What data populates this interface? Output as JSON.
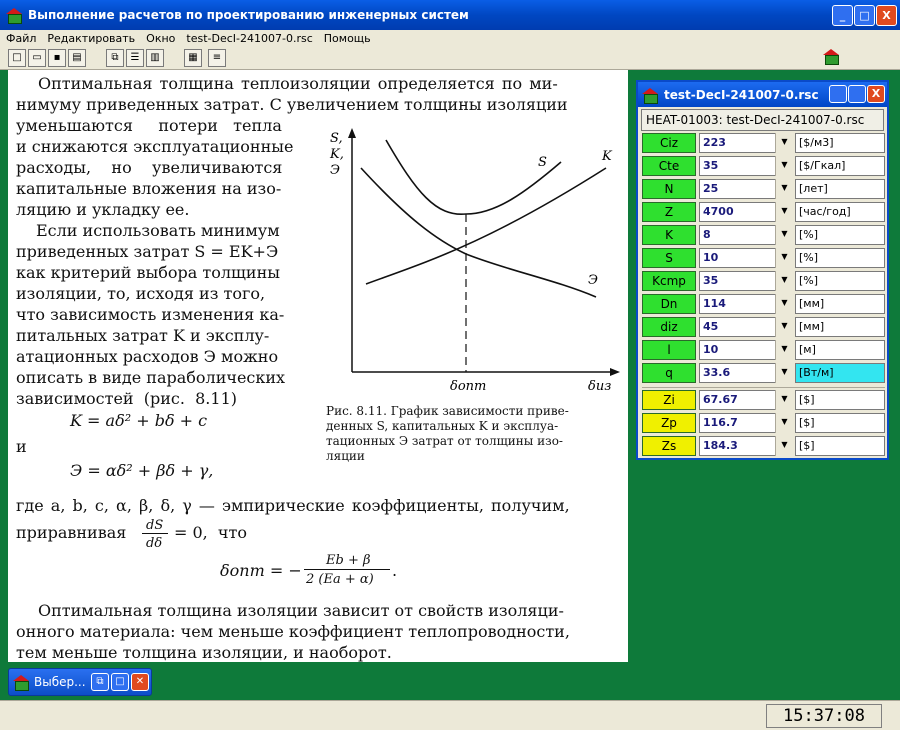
{
  "window": {
    "title": "Выполнение расчетов по проектированию инженерных систем",
    "minimize": "_",
    "maximize": "□",
    "close": "X"
  },
  "menu": [
    "Файл",
    "Редактировать",
    "Окно",
    "test-DecI-241007-0.rsc",
    "Помощь"
  ],
  "toolbar": {
    "icons": [
      "new-icon",
      "open-icon",
      "save-icon",
      "print-icon",
      "cascade-icon",
      "tile-horizontal-icon",
      "tile-vertical-icon",
      "calc-icon",
      "list-icon",
      "home-icon"
    ]
  },
  "document": {
    "lines": [
      "Оптимальная толщина теплоизоляции определяется по ми-",
      "нимуму приведенных затрат. С увеличением толщины изоляции",
      "уменьшаются     потери   тепла",
      "и снижаются эксплуатационные",
      "расходы,    но    увеличиваются",
      "капитальные вложения на изо-",
      "ляцию и укладку ее.",
      "Если использовать минимум",
      "приведенных затрат S = EK+Э",
      "как критерий выбора толщины",
      "изоляции, то, исходя из того,",
      "что зависимость изменения ка-",
      "питальных затрат K и эксплу-",
      "атационных расходов Э можно",
      "описать в виде параболических",
      "зависимостей  (рис.  8.11)",
      "K = aδ² + bδ + c",
      "и",
      "Э = αδ² + βδ + γ,",
      "где a, b, c, α, β, δ, γ — эмпирические коэффициенты, получим,",
      "приравнивая",
      "dS",
      "dδ",
      "= 0,  что",
      "δопт = −",
      "Eb + β",
      "2 (Ea + α)",
      ".",
      "Оптимальная толщина изоляции зависит от свойств изоляци-",
      "онного материала: чем меньше коэффициент теплопроводности,",
      "тем меньше толщина изоляции, и наоборот."
    ],
    "figure": {
      "ylabel_lines": [
        "S,",
        "K,",
        "Э"
      ],
      "curve_labels": [
        "S",
        "K",
        "Э"
      ],
      "xlabel": "δиз",
      "xmark": "δопт",
      "caption": [
        "Рис. 8.11. График зависимости приве-",
        "денных S, капитальных K и эксплуа-",
        "тационных Э затрат от толщины изо-",
        "ляции"
      ]
    }
  },
  "panel": {
    "title": "test-DecI-241007-0.rsc",
    "header": "HEAT-01003:  test-DecI-241007-0.rsc",
    "rows": [
      {
        "label": "Ciz",
        "value": "223",
        "unit": "[$/м3]"
      },
      {
        "label": "Cte",
        "value": "35",
        "unit": "[$/Гкал]"
      },
      {
        "label": "N",
        "value": "25",
        "unit": "[лет]"
      },
      {
        "label": "Z",
        "value": "4700",
        "unit": "[час/год]"
      },
      {
        "label": "K",
        "value": "8",
        "unit": "[%]"
      },
      {
        "label": "S",
        "value": "10",
        "unit": "[%]"
      },
      {
        "label": "Kcmp",
        "value": "35",
        "unit": "[%]"
      },
      {
        "label": "Dn",
        "value": "114",
        "unit": "[мм]"
      },
      {
        "label": "diz",
        "value": "45",
        "unit": "[мм]"
      },
      {
        "label": "l",
        "value": "10",
        "unit": "[м]"
      },
      {
        "label": "q",
        "value": "33.6",
        "unit": "[Вт/м]"
      }
    ],
    "results": [
      {
        "label": "Zi",
        "value": "67.67",
        "unit": "[$]"
      },
      {
        "label": "Zp",
        "value": "116.7",
        "unit": "[$]"
      },
      {
        "label": "Zs",
        "value": "184.3",
        "unit": "[$]"
      }
    ]
  },
  "taskbar": {
    "item": "Выбер..."
  },
  "status": {
    "clock": "15:37:08"
  },
  "colors": {
    "desktop": "#0e7a3a",
    "label_green": "#2fe02f",
    "label_yellow": "#f0f000",
    "highlight": "#33e5f0"
  }
}
